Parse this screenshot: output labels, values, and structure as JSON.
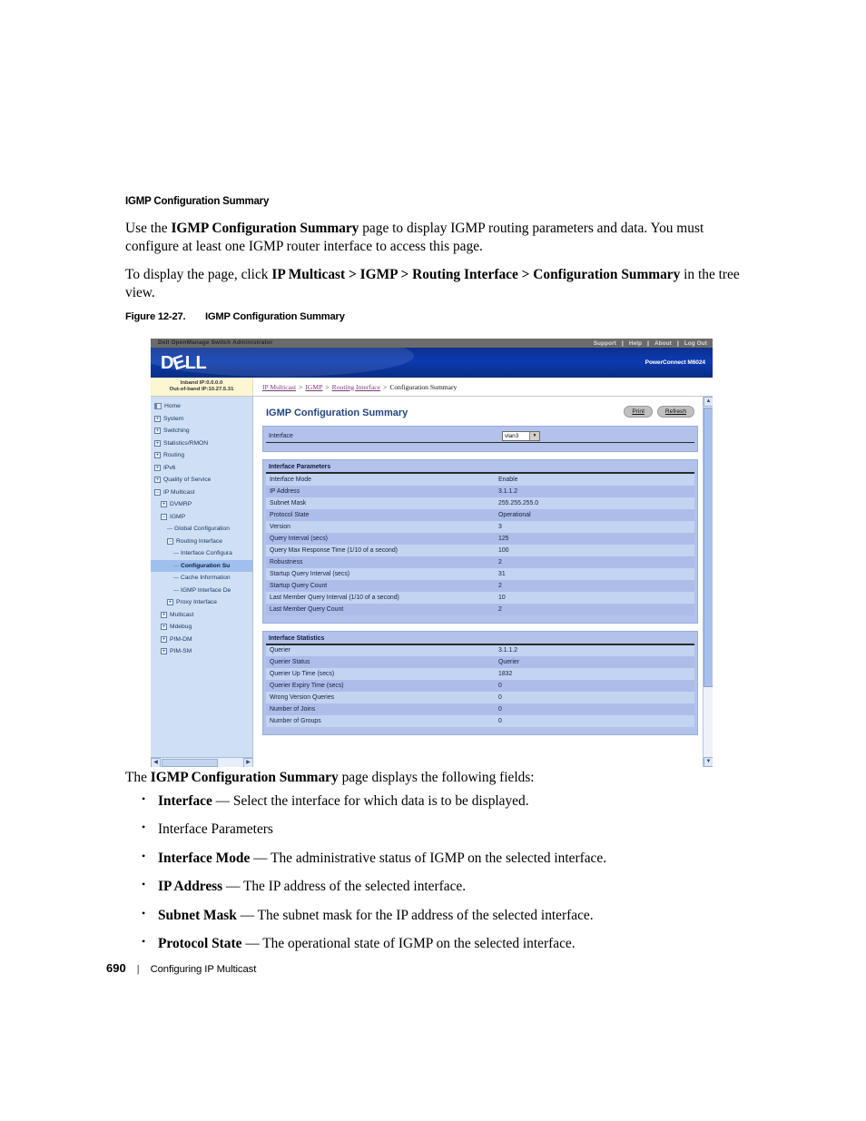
{
  "document": {
    "section_heading": "IGMP Configuration Summary",
    "para1_pre": "Use the ",
    "para1_bold": "IGMP Configuration Summary",
    "para1_post": " page to display IGMP routing parameters and data. You must configure at least one IGMP router interface to access this page.",
    "para2_pre": "To display the page, click ",
    "para2_bold": "IP Multicast > IGMP > Routing Interface > Configuration Summary",
    "para2_post": " in the tree view.",
    "figure_number": "Figure 12-27.",
    "figure_title": "IGMP Configuration Summary",
    "lead_pre": "The ",
    "lead_bold": "IGMP Configuration Summary",
    "lead_post": " page displays the following fields:",
    "bullets": [
      {
        "term": "Interface",
        "desc": " — Select the interface for which data is to be displayed."
      },
      {
        "term": "",
        "desc": "Interface Parameters"
      },
      {
        "term": "Interface Mode",
        "desc": " — The administrative status of IGMP on the selected interface."
      },
      {
        "term": "IP Address",
        "desc": " — The IP address of the selected interface."
      },
      {
        "term": "Subnet Mask",
        "desc": " — The subnet mask for the IP address of the selected interface."
      },
      {
        "term": "Protocol State",
        "desc": " — The operational state of IGMP on the selected interface."
      }
    ],
    "footer": {
      "page_number": "690",
      "divider": "|",
      "title": "Configuring IP Multicast"
    }
  },
  "screenshot": {
    "top_strip": {
      "app_title": "Dell OpenManage Switch Administrator",
      "links": [
        "Support",
        "Help",
        "About",
        "Log Out"
      ],
      "separator": "|"
    },
    "banner": {
      "logo_text_a": "D",
      "logo_text_e": "E",
      "logo_text_b": "LL",
      "model": "PowerConnect M6024"
    },
    "ip_box": {
      "inband": "Inband IP:0.0.0.0",
      "out_of_band": "Out-of-band IP:10.27.5.31"
    },
    "breadcrumb": {
      "items": [
        "IP Multicast",
        "IGMP",
        "Routing Interface",
        "Configuration Summary"
      ],
      "separator": ">"
    },
    "tree": [
      {
        "label": "Home",
        "indent": 0,
        "toggle": "page",
        "selected": false
      },
      {
        "label": "System",
        "indent": 0,
        "toggle": "plus",
        "selected": false
      },
      {
        "label": "Switching",
        "indent": 0,
        "toggle": "plus",
        "selected": false
      },
      {
        "label": "Statistics/RMON",
        "indent": 0,
        "toggle": "plus",
        "selected": false
      },
      {
        "label": "Routing",
        "indent": 0,
        "toggle": "plus",
        "selected": false
      },
      {
        "label": "IPv6",
        "indent": 0,
        "toggle": "plus",
        "selected": false
      },
      {
        "label": "Quality of Service",
        "indent": 0,
        "toggle": "plus",
        "selected": false
      },
      {
        "label": "IP Multicast",
        "indent": 0,
        "toggle": "minus",
        "selected": false
      },
      {
        "label": "DVMRP",
        "indent": 1,
        "toggle": "plus",
        "selected": false
      },
      {
        "label": "IGMP",
        "indent": 1,
        "toggle": "minus",
        "selected": false
      },
      {
        "label": "Global Configuration",
        "indent": 2,
        "toggle": "leaf",
        "selected": false
      },
      {
        "label": "Routing Interface",
        "indent": 2,
        "toggle": "minus",
        "selected": false
      },
      {
        "label": "Interface Configura",
        "indent": 3,
        "toggle": "leaf",
        "selected": false
      },
      {
        "label": "Configuration Su",
        "indent": 3,
        "toggle": "leaf",
        "selected": true
      },
      {
        "label": "Cache Information",
        "indent": 3,
        "toggle": "leaf",
        "selected": false
      },
      {
        "label": "IGMP Interface De",
        "indent": 3,
        "toggle": "leaf",
        "selected": false
      },
      {
        "label": "Proxy Interface",
        "indent": 2,
        "toggle": "plus",
        "selected": false
      },
      {
        "label": "Multicast",
        "indent": 1,
        "toggle": "plus",
        "selected": false
      },
      {
        "label": "Mdebug",
        "indent": 1,
        "toggle": "plus",
        "selected": false
      },
      {
        "label": "PIM-DM",
        "indent": 1,
        "toggle": "plus",
        "selected": false
      },
      {
        "label": "PIM-SM",
        "indent": 1,
        "toggle": "plus",
        "selected": false
      }
    ],
    "page_title": "IGMP Configuration Summary",
    "buttons": {
      "print": "Print",
      "refresh": "Refresh"
    },
    "interface_selector": {
      "label": "Interface",
      "value": "vlan3"
    },
    "interface_parameters": {
      "title": "Interface Parameters",
      "rows": [
        {
          "k": "Interface Mode",
          "v": "Enable"
        },
        {
          "k": "IP Address",
          "v": "3.1.1.2"
        },
        {
          "k": "Subnet Mask",
          "v": "255.255.255.0"
        },
        {
          "k": "Protocol State",
          "v": "Operational"
        },
        {
          "k": "Version",
          "v": "3"
        },
        {
          "k": "Query Interval (secs)",
          "v": "125"
        },
        {
          "k": "Query Max Response Time (1/10 of a second)",
          "v": "100"
        },
        {
          "k": "Robustness",
          "v": "2"
        },
        {
          "k": "Startup Query Interval (secs)",
          "v": "31"
        },
        {
          "k": "Startup Query Count",
          "v": "2"
        },
        {
          "k": "Last Member Query Interval (1/10 of a second)",
          "v": "10"
        },
        {
          "k": "Last Member Query Count",
          "v": "2"
        }
      ]
    },
    "interface_statistics": {
      "title": "Interface Statistics",
      "rows": [
        {
          "k": "Querier",
          "v": "3.1.1.2"
        },
        {
          "k": "Querier Status",
          "v": "Querier"
        },
        {
          "k": "Querier Up Time (secs)",
          "v": "1832"
        },
        {
          "k": "Querier Expiry Time (secs)",
          "v": "0"
        },
        {
          "k": "Wrong Version Queries",
          "v": "0"
        },
        {
          "k": "Number of Joins",
          "v": "0"
        },
        {
          "k": "Number of Groups",
          "v": "0"
        }
      ]
    },
    "colors": {
      "banner_blue": "#0b3bb1",
      "tree_bg": "#cfe0f5",
      "tree_selected": "#9fc0ee",
      "panel_bg": "#b3c2ea",
      "row_odd": "#c2d4f2",
      "row_even": "#adbde9",
      "title_blue": "#23457f",
      "link_purple": "#7a3d7a",
      "ipbox_yellow": "#fdf6d2"
    }
  }
}
